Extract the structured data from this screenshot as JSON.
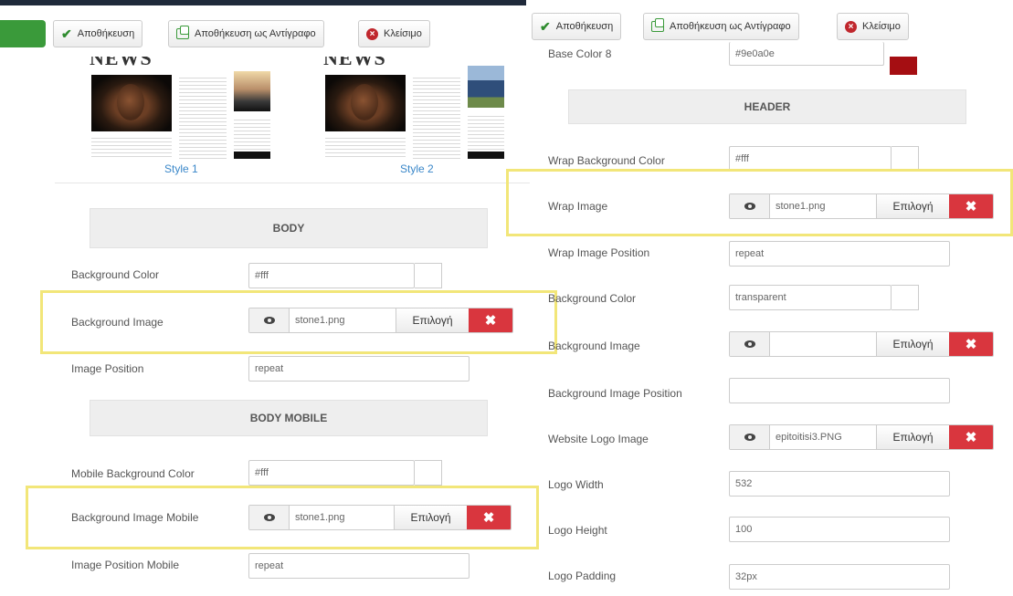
{
  "toolbar_left": {
    "save": "Αποθήκευση",
    "save_copy": "Αποθήκευση ως Αντίγραφο",
    "close": "Κλείσιμο"
  },
  "toolbar_right": {
    "save": "Αποθήκευση",
    "save_copy": "Αποθήκευση ως Αντίγραφο",
    "close": "Κλείσιμο"
  },
  "preview": {
    "headline": "LATEST NEWS",
    "style1": "Style 1",
    "style2": "Style 2"
  },
  "left": {
    "body_section": "BODY",
    "bg_color": {
      "label": "Background Color",
      "value": "#fff"
    },
    "bg_image": {
      "label": "Background Image",
      "value": "stone1.png",
      "pick": "Επιλογή"
    },
    "img_position": {
      "label": "Image Position",
      "value": "repeat"
    },
    "body_mobile_section": "BODY MOBILE",
    "mobile_bg_color": {
      "label": "Mobile Background Color",
      "value": "#fff"
    },
    "bg_image_mobile": {
      "label": "Background Image Mobile",
      "value": "stone1.png",
      "pick": "Επιλογή"
    },
    "img_position_mobile": {
      "label": "Image Position Mobile",
      "value": "repeat"
    }
  },
  "right": {
    "base_color8": {
      "label": "Base Color 8",
      "value": "#9e0a0e",
      "swatch": "#a50e12"
    },
    "header_section": "HEADER",
    "wrap_bg_color": {
      "label": "Wrap Background Color",
      "value": "#fff"
    },
    "wrap_image": {
      "label": "Wrap Image",
      "value": "stone1.png",
      "pick": "Επιλογή"
    },
    "wrap_image_position": {
      "label": "Wrap Image Position",
      "value": "repeat"
    },
    "bg_color": {
      "label": "Background Color",
      "value": "transparent"
    },
    "bg_image": {
      "label": "Background Image",
      "value": "",
      "pick": "Επιλογή"
    },
    "bg_image_position": {
      "label": "Background Image Position",
      "value": ""
    },
    "logo_image": {
      "label": "Website Logo Image",
      "value": "epitoitisi3.PNG",
      "pick": "Επιλογή"
    },
    "logo_width": {
      "label": "Logo Width",
      "value": "532"
    },
    "logo_height": {
      "label": "Logo Height",
      "value": "100"
    },
    "logo_padding": {
      "label": "Logo Padding",
      "value": "32px"
    }
  },
  "icons": {
    "save": "check-icon",
    "save_copy": "copy-icon",
    "close": "close-circle-icon",
    "preview": "eye-icon",
    "remove": "remove-x-icon"
  },
  "colors": {
    "highlight": "#f2e679",
    "danger": "#d9363e",
    "accent_link": "#3a87c9",
    "success": "#3a9a3a"
  }
}
